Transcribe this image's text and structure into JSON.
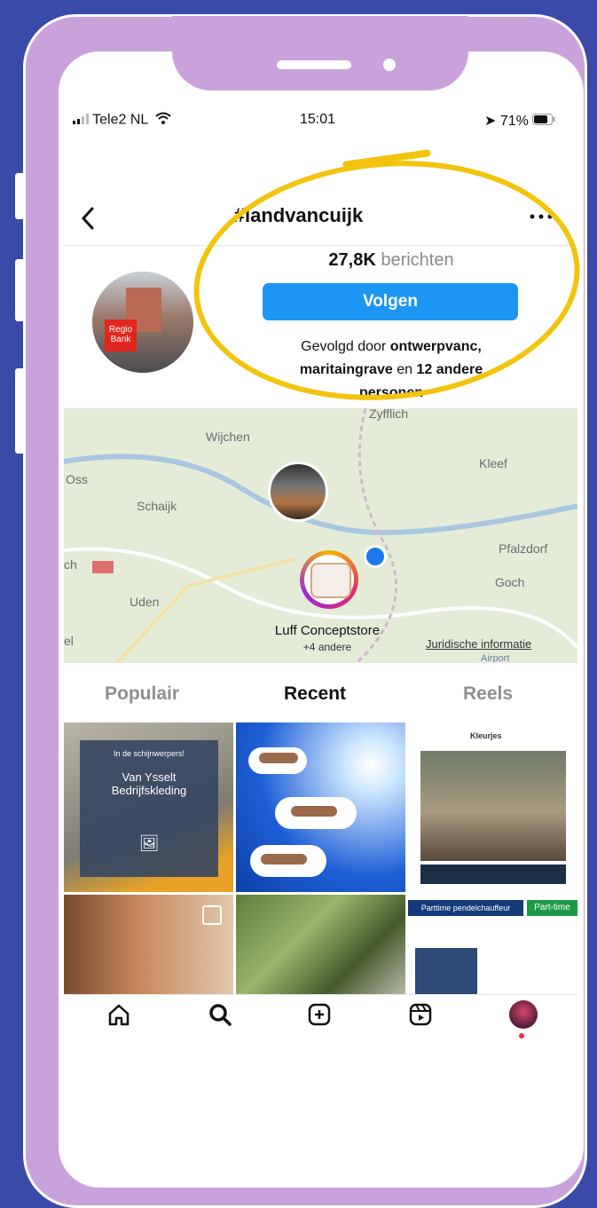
{
  "status_bar": {
    "carrier": "Tele2 NL",
    "time": "15:01",
    "battery": "71%"
  },
  "header": {
    "title": "#landvancuijk",
    "back_icon": "chevron-left-icon",
    "more_icon": "more-icon"
  },
  "profile": {
    "post_count": "27,8K",
    "post_label": "berichten",
    "follow_label": "Volgen",
    "followed_prefix": "Gevolgd door",
    "followed_bold1": "ontwerpvanc,",
    "followed_bold2": "maritaingrave",
    "followed_mid": "en",
    "followed_bold3": "12 andere",
    "followed_suffix": "personen",
    "avatar_text1": "Regio",
    "avatar_text2": "Bank"
  },
  "map": {
    "labels": [
      "Wijchen",
      "Oss",
      "Schaijk",
      "Zyfflich",
      "Kleef",
      "Pfalzdorf",
      "Goch",
      "Uden",
      "ch",
      "el"
    ],
    "place_name": "Luff Conceptstore",
    "place_sub": "+4 andere",
    "legal": "Juridische informatie",
    "airport": "Airport"
  },
  "tabs": {
    "populair": "Populair",
    "recent": "Recent",
    "reels": "Reels"
  },
  "grid": {
    "cell1_small": "In de schijnwerpers!",
    "cell1_title1": "Van Ysselt",
    "cell1_title2": "Bedrijfskleding",
    "cell3_top": "Kleurjes",
    "cell6_title": "Parttime pendelchauffeur",
    "cell6_badge": "Part-time"
  },
  "nav": {
    "home": "home-icon",
    "search": "search-icon",
    "create": "plus-square-icon",
    "reels": "reels-icon",
    "profile": "profile-avatar"
  },
  "colors": {
    "accent": "#1d95f2",
    "highlight": "#f2c40e",
    "frame": "#c9a2db",
    "background": "#3a4aa8"
  }
}
